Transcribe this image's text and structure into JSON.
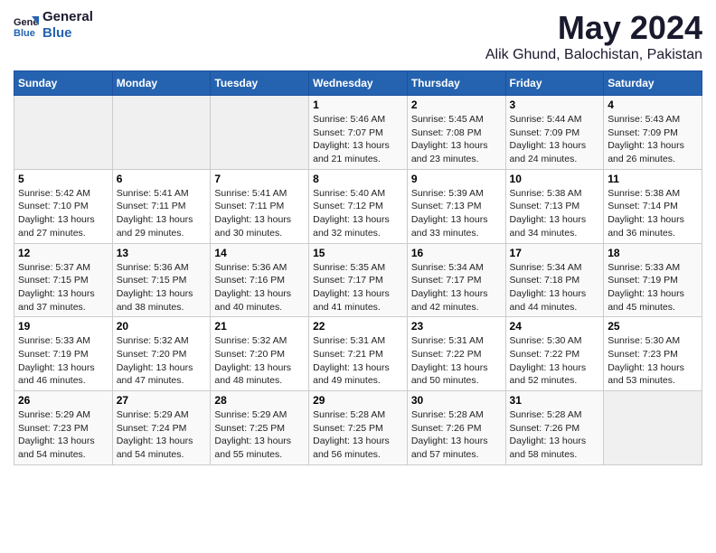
{
  "header": {
    "logo_line1": "General",
    "logo_line2": "Blue",
    "month_year": "May 2024",
    "location": "Alik Ghund, Balochistan, Pakistan"
  },
  "days_of_week": [
    "Sunday",
    "Monday",
    "Tuesday",
    "Wednesday",
    "Thursday",
    "Friday",
    "Saturday"
  ],
  "weeks": [
    [
      {
        "day": "",
        "sunrise": "",
        "sunset": "",
        "daylight": ""
      },
      {
        "day": "",
        "sunrise": "",
        "sunset": "",
        "daylight": ""
      },
      {
        "day": "",
        "sunrise": "",
        "sunset": "",
        "daylight": ""
      },
      {
        "day": "1",
        "sunrise": "Sunrise: 5:46 AM",
        "sunset": "Sunset: 7:07 PM",
        "daylight": "Daylight: 13 hours and 21 minutes."
      },
      {
        "day": "2",
        "sunrise": "Sunrise: 5:45 AM",
        "sunset": "Sunset: 7:08 PM",
        "daylight": "Daylight: 13 hours and 23 minutes."
      },
      {
        "day": "3",
        "sunrise": "Sunrise: 5:44 AM",
        "sunset": "Sunset: 7:09 PM",
        "daylight": "Daylight: 13 hours and 24 minutes."
      },
      {
        "day": "4",
        "sunrise": "Sunrise: 5:43 AM",
        "sunset": "Sunset: 7:09 PM",
        "daylight": "Daylight: 13 hours and 26 minutes."
      }
    ],
    [
      {
        "day": "5",
        "sunrise": "Sunrise: 5:42 AM",
        "sunset": "Sunset: 7:10 PM",
        "daylight": "Daylight: 13 hours and 27 minutes."
      },
      {
        "day": "6",
        "sunrise": "Sunrise: 5:41 AM",
        "sunset": "Sunset: 7:11 PM",
        "daylight": "Daylight: 13 hours and 29 minutes."
      },
      {
        "day": "7",
        "sunrise": "Sunrise: 5:41 AM",
        "sunset": "Sunset: 7:11 PM",
        "daylight": "Daylight: 13 hours and 30 minutes."
      },
      {
        "day": "8",
        "sunrise": "Sunrise: 5:40 AM",
        "sunset": "Sunset: 7:12 PM",
        "daylight": "Daylight: 13 hours and 32 minutes."
      },
      {
        "day": "9",
        "sunrise": "Sunrise: 5:39 AM",
        "sunset": "Sunset: 7:13 PM",
        "daylight": "Daylight: 13 hours and 33 minutes."
      },
      {
        "day": "10",
        "sunrise": "Sunrise: 5:38 AM",
        "sunset": "Sunset: 7:13 PM",
        "daylight": "Daylight: 13 hours and 34 minutes."
      },
      {
        "day": "11",
        "sunrise": "Sunrise: 5:38 AM",
        "sunset": "Sunset: 7:14 PM",
        "daylight": "Daylight: 13 hours and 36 minutes."
      }
    ],
    [
      {
        "day": "12",
        "sunrise": "Sunrise: 5:37 AM",
        "sunset": "Sunset: 7:15 PM",
        "daylight": "Daylight: 13 hours and 37 minutes."
      },
      {
        "day": "13",
        "sunrise": "Sunrise: 5:36 AM",
        "sunset": "Sunset: 7:15 PM",
        "daylight": "Daylight: 13 hours and 38 minutes."
      },
      {
        "day": "14",
        "sunrise": "Sunrise: 5:36 AM",
        "sunset": "Sunset: 7:16 PM",
        "daylight": "Daylight: 13 hours and 40 minutes."
      },
      {
        "day": "15",
        "sunrise": "Sunrise: 5:35 AM",
        "sunset": "Sunset: 7:17 PM",
        "daylight": "Daylight: 13 hours and 41 minutes."
      },
      {
        "day": "16",
        "sunrise": "Sunrise: 5:34 AM",
        "sunset": "Sunset: 7:17 PM",
        "daylight": "Daylight: 13 hours and 42 minutes."
      },
      {
        "day": "17",
        "sunrise": "Sunrise: 5:34 AM",
        "sunset": "Sunset: 7:18 PM",
        "daylight": "Daylight: 13 hours and 44 minutes."
      },
      {
        "day": "18",
        "sunrise": "Sunrise: 5:33 AM",
        "sunset": "Sunset: 7:19 PM",
        "daylight": "Daylight: 13 hours and 45 minutes."
      }
    ],
    [
      {
        "day": "19",
        "sunrise": "Sunrise: 5:33 AM",
        "sunset": "Sunset: 7:19 PM",
        "daylight": "Daylight: 13 hours and 46 minutes."
      },
      {
        "day": "20",
        "sunrise": "Sunrise: 5:32 AM",
        "sunset": "Sunset: 7:20 PM",
        "daylight": "Daylight: 13 hours and 47 minutes."
      },
      {
        "day": "21",
        "sunrise": "Sunrise: 5:32 AM",
        "sunset": "Sunset: 7:20 PM",
        "daylight": "Daylight: 13 hours and 48 minutes."
      },
      {
        "day": "22",
        "sunrise": "Sunrise: 5:31 AM",
        "sunset": "Sunset: 7:21 PM",
        "daylight": "Daylight: 13 hours and 49 minutes."
      },
      {
        "day": "23",
        "sunrise": "Sunrise: 5:31 AM",
        "sunset": "Sunset: 7:22 PM",
        "daylight": "Daylight: 13 hours and 50 minutes."
      },
      {
        "day": "24",
        "sunrise": "Sunrise: 5:30 AM",
        "sunset": "Sunset: 7:22 PM",
        "daylight": "Daylight: 13 hours and 52 minutes."
      },
      {
        "day": "25",
        "sunrise": "Sunrise: 5:30 AM",
        "sunset": "Sunset: 7:23 PM",
        "daylight": "Daylight: 13 hours and 53 minutes."
      }
    ],
    [
      {
        "day": "26",
        "sunrise": "Sunrise: 5:29 AM",
        "sunset": "Sunset: 7:23 PM",
        "daylight": "Daylight: 13 hours and 54 minutes."
      },
      {
        "day": "27",
        "sunrise": "Sunrise: 5:29 AM",
        "sunset": "Sunset: 7:24 PM",
        "daylight": "Daylight: 13 hours and 54 minutes."
      },
      {
        "day": "28",
        "sunrise": "Sunrise: 5:29 AM",
        "sunset": "Sunset: 7:25 PM",
        "daylight": "Daylight: 13 hours and 55 minutes."
      },
      {
        "day": "29",
        "sunrise": "Sunrise: 5:28 AM",
        "sunset": "Sunset: 7:25 PM",
        "daylight": "Daylight: 13 hours and 56 minutes."
      },
      {
        "day": "30",
        "sunrise": "Sunrise: 5:28 AM",
        "sunset": "Sunset: 7:26 PM",
        "daylight": "Daylight: 13 hours and 57 minutes."
      },
      {
        "day": "31",
        "sunrise": "Sunrise: 5:28 AM",
        "sunset": "Sunset: 7:26 PM",
        "daylight": "Daylight: 13 hours and 58 minutes."
      },
      {
        "day": "",
        "sunrise": "",
        "sunset": "",
        "daylight": ""
      }
    ]
  ]
}
